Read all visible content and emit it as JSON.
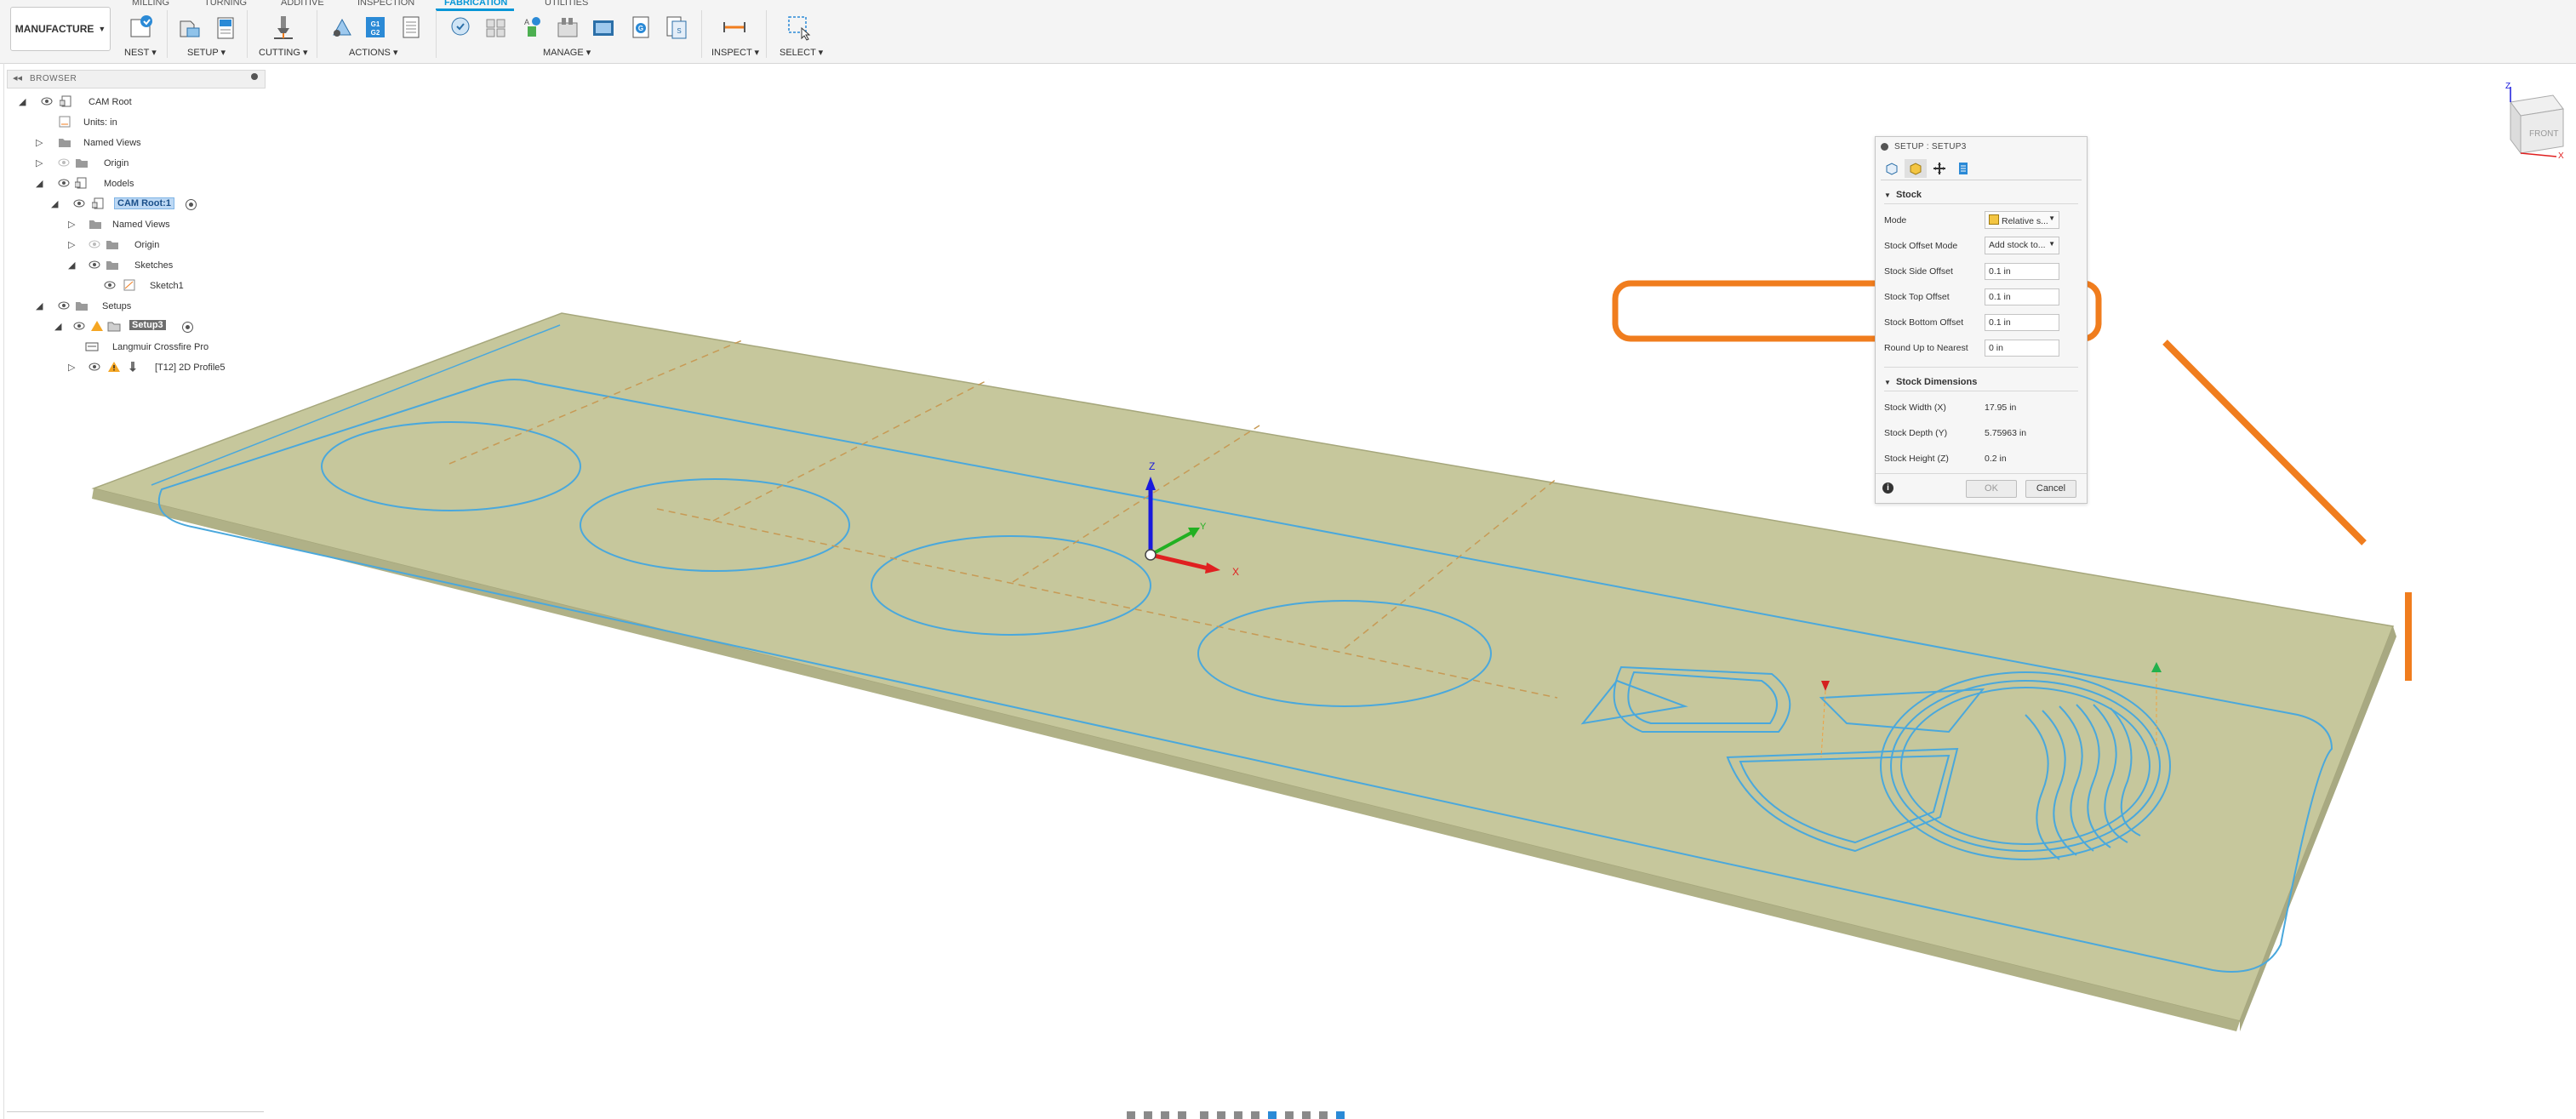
{
  "toolbar": {
    "tabs": [
      {
        "label": "MILLING"
      },
      {
        "label": "TURNING"
      },
      {
        "label": "ADDITIVE"
      },
      {
        "label": "INSPECTION"
      },
      {
        "label": "FABRICATION"
      },
      {
        "label": "UTILITIES"
      }
    ],
    "workspace": "MANUFACTURE",
    "groups": {
      "nest": "NEST",
      "setup": "SETUP",
      "cutting": "CUTTING",
      "actions": "ACTIONS",
      "manage": "MANAGE",
      "inspect": "INSPECT",
      "select": "SELECT"
    },
    "icon_text": {
      "gcode": "G1\nG2",
      "g": "G"
    }
  },
  "browser": {
    "title": "BROWSER",
    "items": [
      {
        "label": "CAM Root"
      },
      {
        "label": "Units: in"
      },
      {
        "label": "Named Views"
      },
      {
        "label": "Origin"
      },
      {
        "label": "Models"
      },
      {
        "label": "CAM Root:1"
      },
      {
        "label": "Named Views"
      },
      {
        "label": "Origin"
      },
      {
        "label": "Sketches"
      },
      {
        "label": "Sketch1"
      },
      {
        "label": "Setups"
      },
      {
        "label": "Setup3"
      },
      {
        "label": "Langmuir Crossfire Pro"
      },
      {
        "label": "[T12] 2D Profile5"
      }
    ]
  },
  "dialog": {
    "title": "SETUP : SETUP3",
    "stock": {
      "heading": "Stock",
      "mode_label": "Mode",
      "mode_value": "Relative s...",
      "offset_mode_label": "Stock Offset Mode",
      "offset_mode_value": "Add stock to...",
      "side_label": "Stock Side Offset",
      "side_value": "0.1 in",
      "top_label": "Stock Top Offset",
      "top_value": "0.1 in",
      "bottom_label": "Stock Bottom Offset",
      "bottom_value": "0.1 in",
      "round_label": "Round Up to Nearest",
      "round_value": "0 in"
    },
    "dimensions": {
      "heading": "Stock Dimensions",
      "width_label": "Stock Width (X)",
      "width_value": "17.95 in",
      "depth_label": "Stock Depth (Y)",
      "depth_value": "5.75963 in",
      "height_label": "Stock Height (Z)",
      "height_value": "0.2 in"
    },
    "ok": "OK",
    "cancel": "Cancel"
  },
  "viewport": {
    "axis_labels": {
      "z": "Z",
      "y": "Y",
      "x": "X"
    },
    "viewcube": {
      "face": "FRONT",
      "z": "Z",
      "x": "X"
    }
  },
  "colors": {
    "accent": "#0696d7",
    "stock_fill": "#c6c79c",
    "toolpath": "#4aa8dc",
    "annotation": "#f07d1e"
  }
}
